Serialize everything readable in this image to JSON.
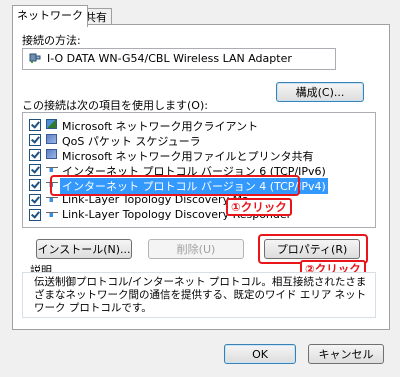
{
  "tabs": [
    {
      "label": "ネットワーク",
      "active": true
    },
    {
      "label": "共有",
      "active": false
    }
  ],
  "connect_using": {
    "label": "接続の方法:",
    "adapter": "I-O DATA WN-G54/CBL Wireless LAN Adapter",
    "adapter_icon": "network-adapter-icon",
    "configure_label": "構成(C)..."
  },
  "items_section": {
    "label": "この接続は次の項目を使用します(O):",
    "items": [
      {
        "text": "Microsoft ネットワーク用クライアント",
        "checked": true,
        "icon": "client-icon",
        "selected": false
      },
      {
        "text": "QoS パケット スケジューラ",
        "checked": true,
        "icon": "service-icon",
        "selected": false
      },
      {
        "text": "Microsoft ネットワーク用ファイルとプリンタ共有",
        "checked": true,
        "icon": "service-icon",
        "selected": false
      },
      {
        "text": "インターネット プロトコル バージョン 6 (TCP/IPv6)",
        "checked": true,
        "icon": "protocol-icon",
        "selected": false
      },
      {
        "text": "インターネット プロトコル バージョン 4 (TCP/IPv4)",
        "checked": true,
        "icon": "protocol-icon",
        "selected": true
      },
      {
        "text": "Link-Layer Topology Discovery Ma",
        "checked": true,
        "icon": "protocol-icon",
        "selected": false
      },
      {
        "text": "Link-Layer Topology Discovery Responder",
        "checked": true,
        "icon": "protocol-icon",
        "selected": false
      }
    ]
  },
  "annotations": {
    "step1": "①クリック",
    "step2": "②クリック",
    "color": "#e8161b"
  },
  "buttons": {
    "install": "インストール(N)...",
    "uninstall": "削除(U)",
    "properties": "プロパティ(R)",
    "ok": "OK",
    "cancel": "キャンセル"
  },
  "description": {
    "label": "説明",
    "text": "伝送制御プロトコル/インターネット プロトコル。相互接続されたさまざまなネットワーク間の通信を提供する、既定のワイド エリア ネットワーク プロトコルです。"
  },
  "colors": {
    "selection": "#3399ff",
    "dialog_bg": "#f0f0f0"
  }
}
